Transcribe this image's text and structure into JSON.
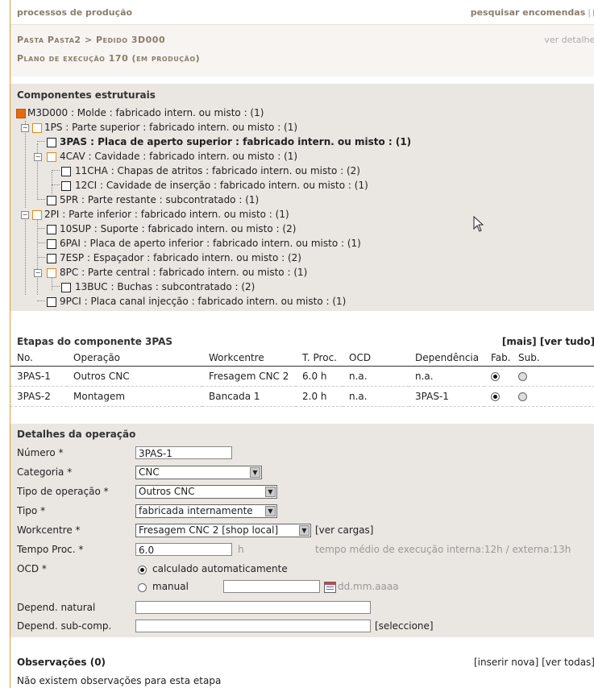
{
  "topbar": {
    "left": "processos de produção",
    "right": "pesquisar encomendas",
    "sep": "|"
  },
  "header": {
    "breadcrumb": "Pasta Pasta2 > Pedido 3D000",
    "plan": "Plano de execução 170 (em produção)",
    "details": "ver detalhes"
  },
  "components": {
    "title": "Componentes estruturais",
    "items": [
      "M3D000 : Molde : fabricado intern. ou misto : (1)",
      "1PS : Parte superior : fabricado intern. ou misto : (1)",
      "3PAS : Placa de aperto superior : fabricado intern. ou misto : (1)",
      "4CAV : Cavidade : fabricado intern. ou misto : (1)",
      "11CHA : Chapas de atritos : fabricado intern. ou misto : (2)",
      "12CI : Cavidade de inserção : fabricado intern. ou misto : (1)",
      "5PR : Parte restante : subcontratado : (1)",
      "2PI : Parte inferior : fabricado intern. ou misto : (1)",
      "10SUP : Suporte : fabricado intern. ou misto : (2)",
      "6PAI : Placa de aperto inferior : fabricado intern. ou misto : (1)",
      "7ESP : Espaçador : fabricado intern. ou misto : (2)",
      "8PC : Parte central : fabricado intern. ou misto : (1)",
      "13BUC : Buchas : subcontratado : (2)",
      "9PCI : Placa canal injecção : fabricado intern. ou misto : (1)"
    ]
  },
  "stages": {
    "title": "Etapas do componente 3PAS",
    "links": "[mais] [ver tudo]",
    "headers": [
      "No.",
      "Operação",
      "Workcentre",
      "T. Proc.",
      "OCD",
      "Dependência",
      "Fab.",
      "Sub."
    ],
    "rows": [
      [
        "3PAS-1",
        "Outros CNC",
        "Fresagem CNC 2",
        "6.0 h",
        "n.a.",
        "n.a."
      ],
      [
        "3PAS-2",
        "Montagem",
        "Bancada 1",
        "2.0 h",
        "n.a.",
        "3PAS-1"
      ]
    ]
  },
  "details": {
    "title": "Detalhes da operação",
    "numero_label": "Número *",
    "numero_value": "3PAS-1",
    "categoria_label": "Categoria *",
    "categoria_value": "CNC",
    "tipo_op_label": "Tipo de operação *",
    "tipo_op_value": "Outros CNC",
    "tipo_label": "Tipo *",
    "tipo_value": "fabricada internamente",
    "workcentre_label": "Workcentre *",
    "workcentre_value": "Fresagem CNC 2 [shop local]",
    "ver_cargas": "[ver cargas]",
    "tempo_label": "Tempo Proc. *",
    "tempo_value": "6.0",
    "tempo_unit": "h",
    "tempo_info": "tempo médio de execução interna:12h / externa:13h",
    "ocd_label": "OCD *",
    "ocd_auto": "calculado automaticamente",
    "ocd_manual": "manual",
    "date_placeholder": "dd.mm.aaaa",
    "depend_natural_label": "Depend. natural",
    "depend_sub_label": "Depend. sub-comp.",
    "seleccione": "[seleccione]"
  },
  "observations": {
    "title": "Observações (0)",
    "links": "[inserir nova] [ver todas]",
    "empty": "Não existem observações para esta etapa"
  }
}
